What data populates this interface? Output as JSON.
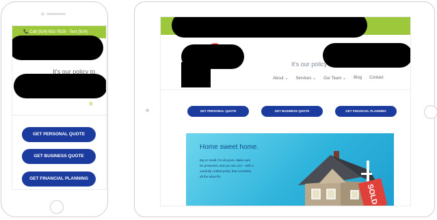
{
  "phone": {
    "call_text": "📞 Call (914) 632-7628 · Text (914)",
    "tagline": "It's our policy to",
    "menu_icon": "≡",
    "buttons": [
      {
        "label": "GET PERSONAL QUOTE"
      },
      {
        "label": "GET BUSINESS QUOTE"
      },
      {
        "label": "GET FINANCIAL PLANNING"
      }
    ]
  },
  "tablet": {
    "tagline": "It's our policy to",
    "nav": [
      {
        "label": "About ⌄"
      },
      {
        "label": "Services ⌄"
      },
      {
        "label": "Our Team ⌄"
      },
      {
        "label": "Blog"
      },
      {
        "label": "Contact"
      }
    ],
    "buttons": [
      {
        "label": "GET PERSONAL QUOTE"
      },
      {
        "label": "GET BUSINESS QUOTE"
      },
      {
        "label": "GET FINANCIAL PLANNING"
      }
    ],
    "hero": {
      "title": "Home sweet home.",
      "lines": [
        "Big or small, it's all yours. Make sure",
        "it's protected, and you are, too – with a",
        "carefully crafted policy that considers",
        "all the what-if's."
      ],
      "sign_text": "SOLD"
    }
  },
  "colors": {
    "accent_green": "#9dc83b",
    "button_blue": "#1b3c9e",
    "hero_blue": "#2fb4dc",
    "sign_red": "#e0403a"
  }
}
